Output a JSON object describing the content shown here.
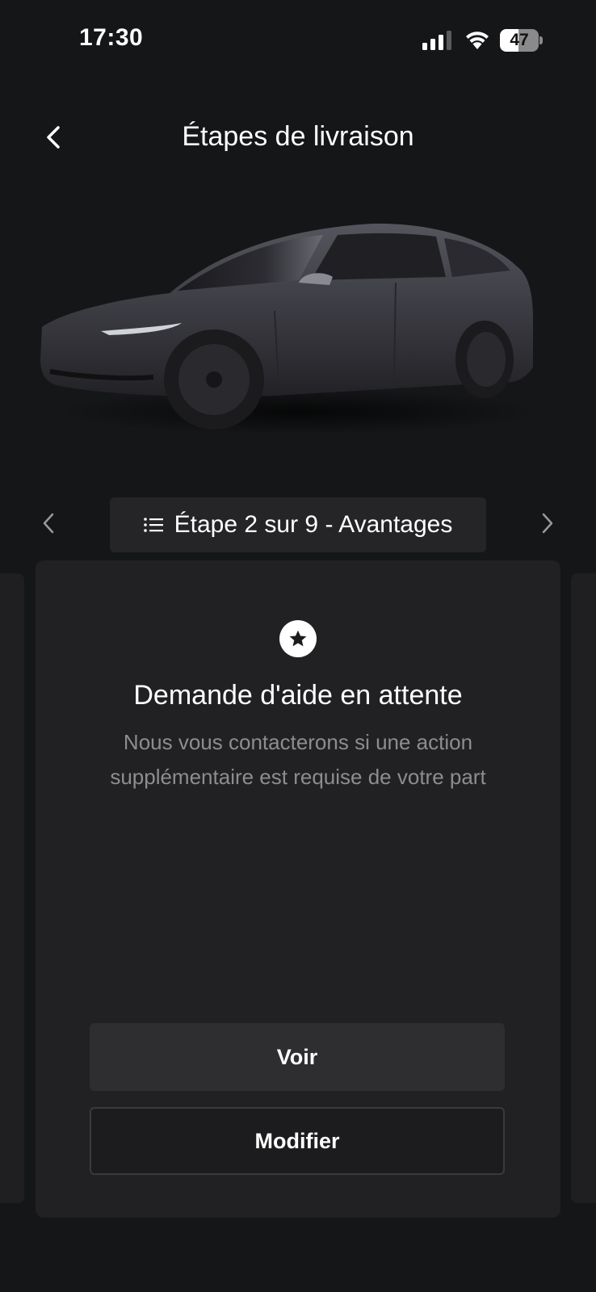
{
  "status_bar": {
    "time": "17:30",
    "battery_level": "47",
    "battery_fraction": 0.47
  },
  "header": {
    "back_icon": "chevron-left-icon",
    "title": "Étapes de livraison"
  },
  "step_nav": {
    "prev_icon": "chevron-left-icon",
    "next_icon": "chevron-right-icon",
    "list_icon": "list-icon",
    "label": "Étape 2 sur 9 - Avantages"
  },
  "card": {
    "icon": "star-icon",
    "title": "Demande d'aide en attente",
    "description": "Nous vous contacterons si une action supplémentaire est requise de votre part",
    "primary_button": "Voir",
    "secondary_button": "Modifier"
  },
  "colors": {
    "background": "#151618",
    "card": "#212123",
    "pill": "#252527",
    "muted_text": "#8d8d90",
    "car_body": "#3a3a40"
  }
}
